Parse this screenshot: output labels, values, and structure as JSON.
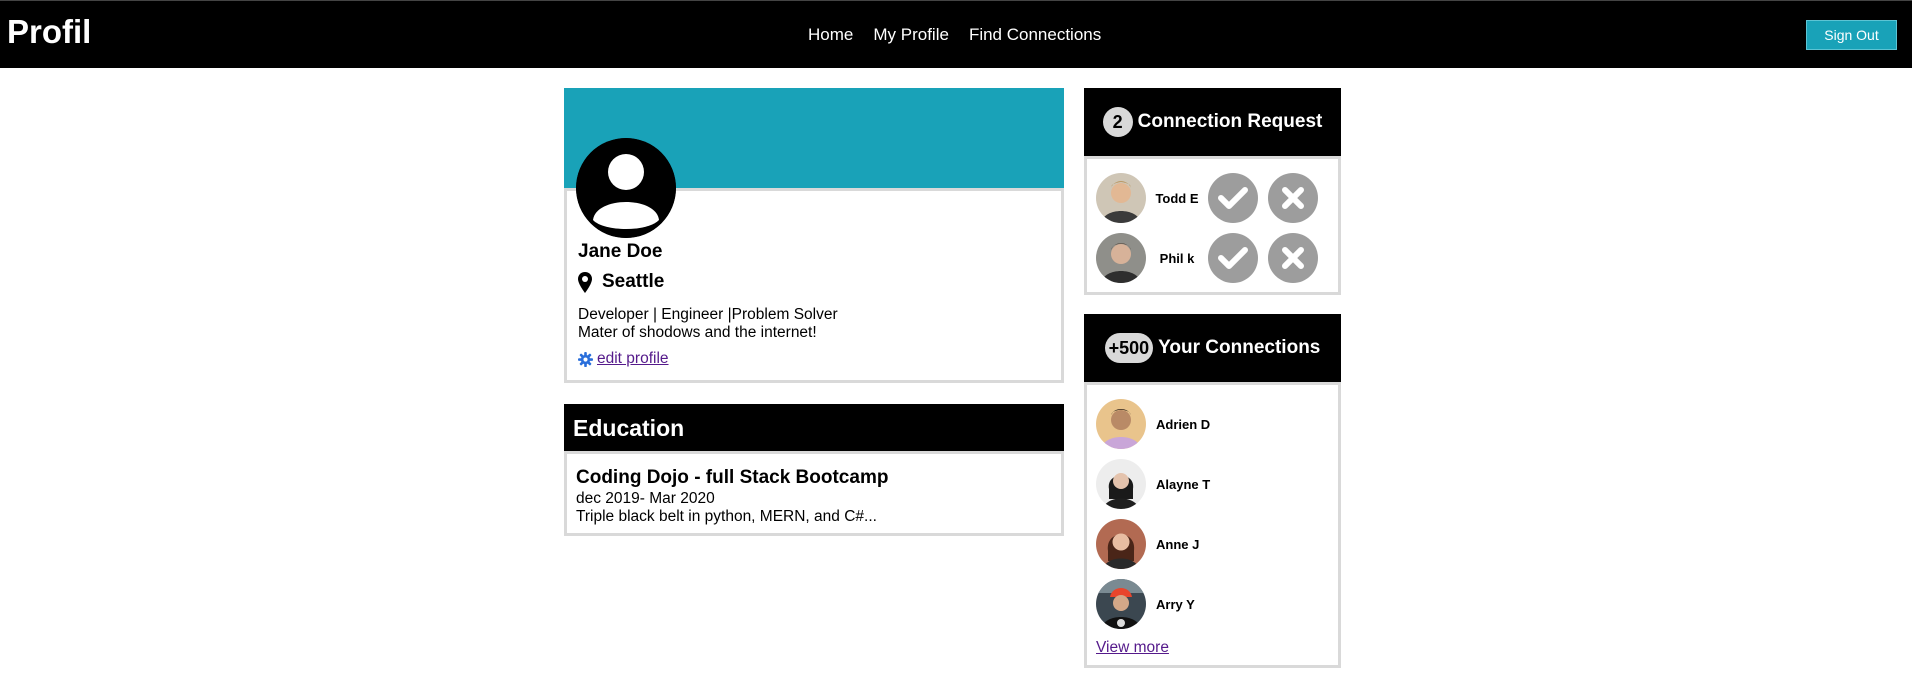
{
  "header": {
    "brand": "Profil",
    "nav": [
      "Home",
      "My Profile",
      "Find Connections"
    ],
    "sign_out": "Sign Out"
  },
  "profile": {
    "name": "Jane Doe",
    "city": "Seattle",
    "bio_line1": "Developer | Engineer |Problem Solver",
    "bio_line2": "Mater of shodows and the internet!",
    "edit_label": "edit profile",
    "banner_color": "#19a2b8"
  },
  "education": {
    "title": "Education",
    "school": "Coding Dojo - full Stack Bootcamp",
    "dates": "dec 2019- Mar 2020",
    "description": "Triple black belt in python, MERN, and C#..."
  },
  "requests": {
    "count": "2",
    "title": "Connection Request",
    "items": [
      {
        "name": "Todd E",
        "avatar": "photo-avatar"
      },
      {
        "name": "Phil k",
        "avatar": "photo-avatar"
      }
    ]
  },
  "connections": {
    "count": "+500",
    "title": "Your Connections",
    "items": [
      {
        "name": "Adrien D"
      },
      {
        "name": "Alayne T"
      },
      {
        "name": "Anne J"
      },
      {
        "name": "Arry Y"
      }
    ],
    "view_more": "View more"
  },
  "icons": {
    "location": "map-pin-icon",
    "edit": "gear-icon",
    "accept": "check-icon",
    "decline": "x-icon"
  },
  "colors": {
    "accent": "#19a2b8",
    "header_bg": "#000000",
    "link": "#551a8b",
    "action_button": "#9d9d9d"
  }
}
